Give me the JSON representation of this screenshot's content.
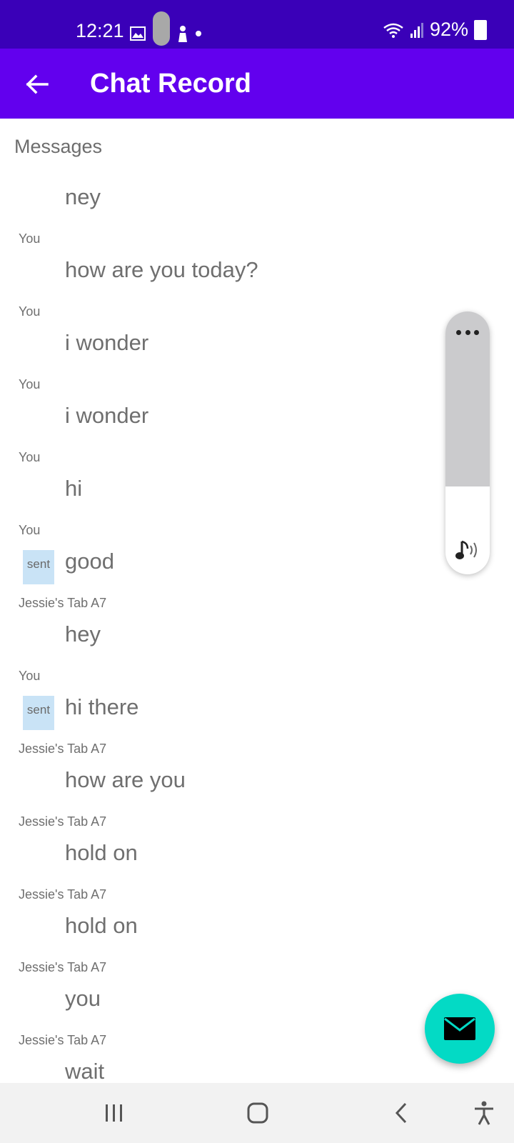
{
  "status_bar": {
    "time": "12:21",
    "battery": "92%"
  },
  "app_bar": {
    "title": "Chat Record"
  },
  "section": {
    "title": "Messages"
  },
  "messages": [
    {
      "sender": "",
      "text": "ney",
      "sent": ""
    },
    {
      "sender": "You",
      "text": "how are you today?",
      "sent": ""
    },
    {
      "sender": "You",
      "text": "i wonder",
      "sent": ""
    },
    {
      "sender": "You",
      "text": "i wonder",
      "sent": ""
    },
    {
      "sender": "You",
      "text": "hi",
      "sent": ""
    },
    {
      "sender": "You",
      "text": "good",
      "sent": "sent"
    },
    {
      "sender": "Jessie's Tab A7",
      "text": "hey",
      "sent": ""
    },
    {
      "sender": "You",
      "text": "hi there",
      "sent": "sent"
    },
    {
      "sender": "Jessie's Tab A7",
      "text": "how are you",
      "sent": ""
    },
    {
      "sender": "Jessie's Tab A7",
      "text": "hold on",
      "sent": ""
    },
    {
      "sender": "Jessie's Tab A7",
      "text": "hold on",
      "sent": ""
    },
    {
      "sender": "Jessie's Tab A7",
      "text": "you",
      "sent": ""
    },
    {
      "sender": "Jessie's Tab A7",
      "text": "wait",
      "sent": ""
    }
  ],
  "colors": {
    "status_bar": "#3a00b8",
    "app_bar": "#6200ee",
    "fab": "#03dac5",
    "sent_badge": "#c9e3f6"
  },
  "icons": {
    "back": "arrow-left-icon",
    "fab": "envelope-icon",
    "panel_top": "more-horizontal-icon",
    "panel_bottom": "music-sound-icon"
  }
}
